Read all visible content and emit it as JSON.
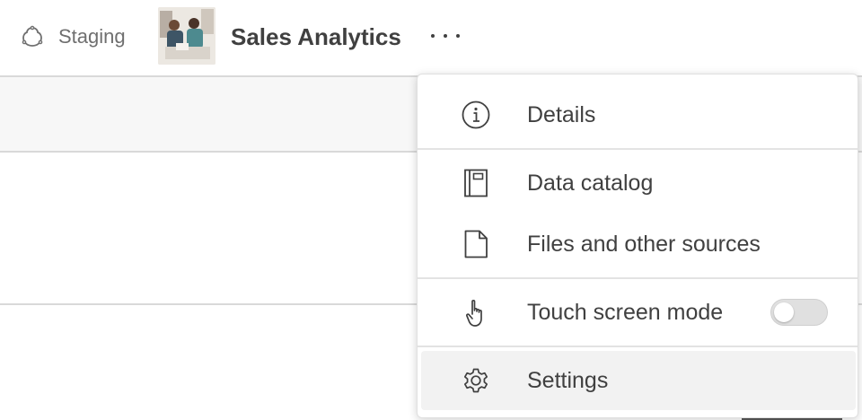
{
  "header": {
    "space_label": "Staging",
    "space_icon": "space-icon",
    "app_title": "Sales Analytics",
    "more_icon": "more-horizontal-icon"
  },
  "menu": {
    "items": [
      {
        "label": "Details",
        "icon": "info-icon"
      },
      {
        "label": "Data catalog",
        "icon": "book-icon"
      },
      {
        "label": "Files and other sources",
        "icon": "file-icon"
      },
      {
        "label": "Touch screen mode",
        "icon": "touch-hand-icon",
        "toggle_on": false
      },
      {
        "label": "Settings",
        "icon": "gear-icon",
        "hovered": true
      }
    ]
  },
  "colors": {
    "text": "#404040",
    "muted_text": "#6f6f6f",
    "border": "#d9d9d9",
    "hover_bg": "#f2f2f2",
    "toggle_off_bg": "#e0e0e0"
  }
}
